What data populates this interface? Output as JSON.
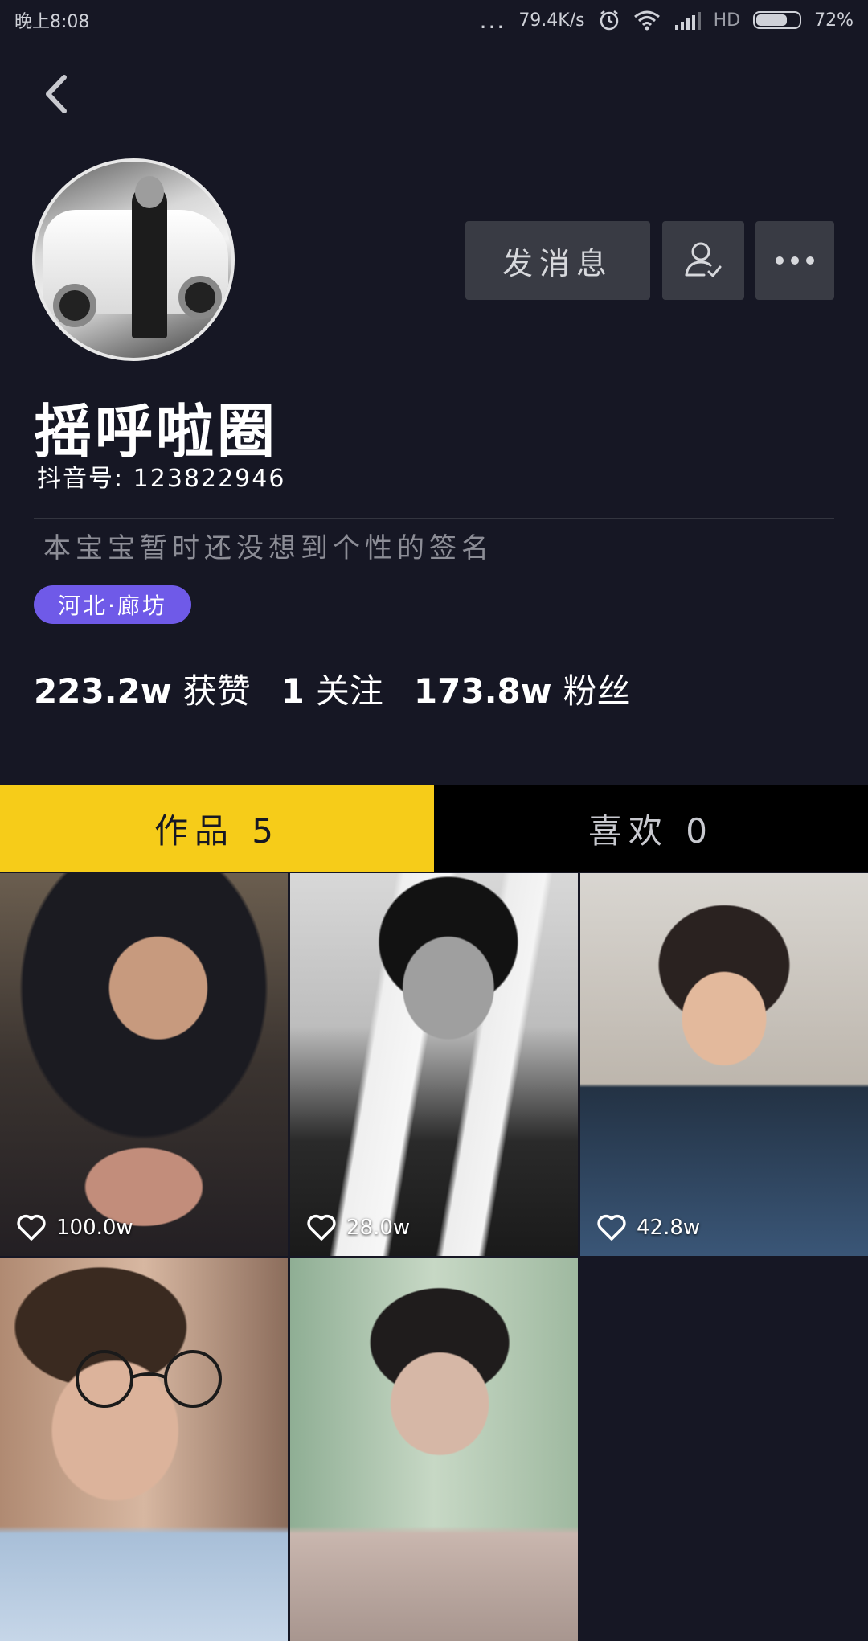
{
  "status_bar": {
    "time": "晚上8:08",
    "dots": "...",
    "network_speed": "79.4K/s",
    "hd_label": "HD",
    "battery_text": "72%",
    "battery_level": 0.72
  },
  "profile": {
    "nickname": "摇呼啦圈",
    "douyin_id": "抖音号: 123822946",
    "signature": "本宝宝暂时还没想到个性的签名",
    "location": "河北·廊坊"
  },
  "actions": {
    "message_label": "发消息",
    "follow_icon": "user-check-icon",
    "more_icon": "more-dots-icon"
  },
  "stats": {
    "likes_num": "223.2w",
    "likes_label": "获赞",
    "following_num": "1",
    "following_label": "关注",
    "followers_num": "173.8w",
    "followers_label": "粉丝"
  },
  "tabs": {
    "works": "作品 5",
    "liked": "喜欢 0"
  },
  "videos": [
    {
      "likes": "100.0w"
    },
    {
      "likes": "28.0w"
    },
    {
      "likes": "42.8w"
    },
    {
      "likes": ""
    },
    {
      "likes": ""
    }
  ],
  "colors": {
    "background": "#161724",
    "tab_active": "#f6cc19",
    "location_tag": "#6f5ae8",
    "button_bg": "#393b44"
  }
}
